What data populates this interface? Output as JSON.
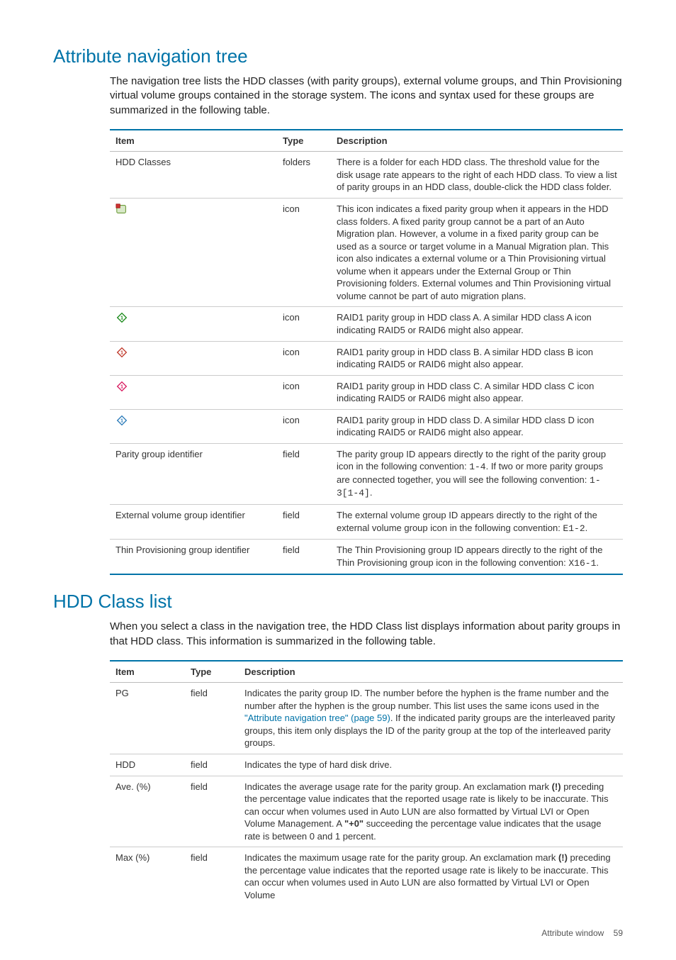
{
  "section1": {
    "heading": "Attribute navigation tree",
    "intro": "The navigation tree lists the HDD classes (with parity groups), external volume groups, and Thin Provisioning virtual volume groups contained in the storage system. The icons and syntax used for these groups are summarized in the following table.",
    "headers": {
      "col1": "Item",
      "col2": "Type",
      "col3": "Description"
    },
    "rows": [
      {
        "item_text": "HDD Classes",
        "type": "folders",
        "desc": "There is a folder for each HDD class. The threshold value for the disk usage rate appears to the right of each HDD class. To view a list of parity groups in an HDD class, double-click the HDD class folder."
      },
      {
        "item_icon": "fixed-parity-icon",
        "type": "icon",
        "desc": "This icon indicates a fixed parity group when it appears in the HDD class folders. A fixed parity group cannot be a part of an Auto Migration plan. However, a volume in a fixed parity group can be used as a source or target volume in a Manual Migration plan. This icon also indicates a external volume or a Thin Provisioning virtual volume when it appears under the External Group or Thin Provisioning folders. External volumes and Thin Provisioning virtual volume cannot be part of auto migration plans."
      },
      {
        "item_icon": "raid-class-a-icon",
        "type": "icon",
        "desc": "RAID1 parity group in HDD class A. A similar HDD class A icon indicating RAID5 or RAID6 might also appear."
      },
      {
        "item_icon": "raid-class-b-icon",
        "type": "icon",
        "desc": "RAID1 parity group in HDD class B. A similar HDD class B icon indicating RAID5 or RAID6 might also appear."
      },
      {
        "item_icon": "raid-class-c-icon",
        "type": "icon",
        "desc": "RAID1 parity group in HDD class C. A similar HDD class C icon indicating RAID5 or RAID6 might also appear."
      },
      {
        "item_icon": "raid-class-d-icon",
        "type": "icon",
        "desc": "RAID1 parity group in HDD class D. A similar HDD class D icon indicating RAID5 or RAID6 might also appear."
      },
      {
        "item_text": "Parity group identifier",
        "type": "field",
        "desc_html": "The parity group ID appears directly to the right of the parity group icon in the following convention: <span class=\"mono-inline\">1-4</span>. If two or more parity groups are connected together, you will see the following convention: <span class=\"mono-inline\">1-3[1-4]</span>."
      },
      {
        "item_text": "External volume group identifier",
        "type": "field",
        "desc_html": "The external volume group ID appears directly to the right of the external volume group icon in the following convention: <span class=\"mono-inline\">E1-2</span>."
      },
      {
        "item_text": "Thin Provisioning group identifier",
        "type": "field",
        "desc_html": "The Thin Provisioning group ID appears directly to the right of the Thin Provisioning group icon in the following convention: <span class=\"mono-inline\">X16-1</span>."
      }
    ]
  },
  "section2": {
    "heading": "HDD Class list",
    "intro": "When you select a class in the navigation tree, the HDD Class list displays information about parity groups in that HDD class. This information is summarized in the following table.",
    "headers": {
      "col1": "Item",
      "col2": "Type",
      "col3": "Description"
    },
    "rows": [
      {
        "item_text": "PG",
        "type": "field",
        "desc_html": "Indicates the parity group ID. The number before the hyphen is the frame number and the number after the hyphen is the group number. This list uses the same icons used in the <a href=\"#\">\"Attribute navigation tree\" (page 59)</a>. If the indicated parity groups are the interleaved parity groups, this item only displays the ID of the parity group at the top of the interleaved parity groups."
      },
      {
        "item_text": "HDD",
        "type": "field",
        "desc": "Indicates the type of hard disk drive."
      },
      {
        "item_text": "Ave. (%)",
        "type": "field",
        "desc_html": "Indicates the average usage rate for the parity group. An exclamation mark <span class=\"strong\">(!)</span> preceding the percentage value indicates that the reported usage rate is likely to be inaccurate. This can occur when volumes used in Auto LUN are also formatted by Virtual LVI or Open Volume Management. A <span class=\"strong\">\"+0\"</span> succeeding the percentage value indicates that the usage rate is between 0 and 1 percent."
      },
      {
        "item_text": "Max (%)",
        "type": "field",
        "desc_html": "Indicates the maximum usage rate for the parity group. An exclamation mark <span class=\"strong\">(!)</span> preceding the percentage value indicates that the reported usage rate is likely to be inaccurate. This can occur when volumes used in Auto LUN are also formatted by Virtual LVI or Open Volume"
      }
    ]
  },
  "footer": {
    "label": "Attribute window",
    "page": "59"
  },
  "icons": {
    "fixed-parity-icon": {
      "bg": "#d8e8c8",
      "border": "#6b9b37",
      "accent": "#c33"
    },
    "raid-class-a-icon": {
      "bg": "#ffffff",
      "border": "#1a8a1a",
      "accent": "#1a8a1a"
    },
    "raid-class-b-icon": {
      "bg": "#ffffff",
      "border": "#c0392b",
      "accent": "#c0392b"
    },
    "raid-class-c-icon": {
      "bg": "#ffffff",
      "border": "#d81b60",
      "accent": "#d81b60"
    },
    "raid-class-d-icon": {
      "bg": "#ffffff",
      "border": "#2b7bb9",
      "accent": "#2b7bb9"
    }
  }
}
